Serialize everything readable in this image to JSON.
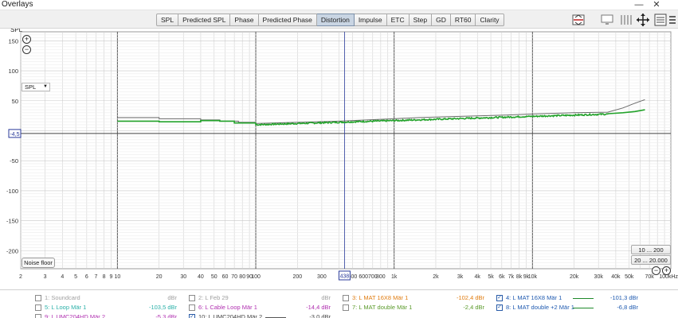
{
  "window": {
    "title": "Overlays",
    "minimize": "—",
    "close": "✕"
  },
  "toolbar": {
    "tabs": [
      "SPL",
      "Predicted SPL",
      "Phase",
      "Predicted Phase",
      "Distortion",
      "Impulse",
      "ETC",
      "Step",
      "GD",
      "RT60",
      "Clarity"
    ],
    "active_tab": "Distortion",
    "right_icons": [
      "compare-icon",
      "monitor-icon",
      "columns-icon",
      "move-arrows-icon",
      "controls-icon",
      "menu-icon"
    ]
  },
  "plot": {
    "y_axis_label": "SPL",
    "y_ticks": [
      "150",
      "100",
      "50",
      "-50",
      "-100",
      "-150",
      "-200"
    ],
    "y_marker": "-4,5",
    "x_ticks": [
      "2",
      "3",
      "4",
      "5",
      "6",
      "7",
      "8",
      "9",
      "10",
      "20",
      "30",
      "40",
      "50",
      "60",
      "70",
      "80",
      "90",
      "100",
      "200",
      "300",
      "500",
      "600",
      "700",
      "800",
      "1k",
      "2k",
      "3k",
      "4k",
      "5k",
      "6k",
      "7k",
      "8k",
      "9k",
      "10k",
      "20k",
      "30k",
      "40k",
      "50k",
      "70k",
      "100kHz"
    ],
    "x_marker": "438",
    "dropdown": "SPL",
    "noise_floor_button": "Noise floor",
    "range_buttons": [
      "10 ... 200",
      "20 ... 20.000"
    ],
    "zoom_in": "+",
    "zoom_out": "−",
    "colors": {
      "trace_green": "#22a22a",
      "trace_gray": "#6a6a6a",
      "cursor": "#2a3a9a"
    }
  },
  "legend": [
    {
      "num_name": "1: Soundcard",
      "value": "dBr",
      "checked": false,
      "color": "#a0a0a0",
      "text_color": "#a0a0a0"
    },
    {
      "num_name": "2: L Feb 29",
      "value": "dBr",
      "checked": false,
      "color": "#a0a0a0",
      "text_color": "#a0a0a0"
    },
    {
      "num_name": "3: L MAT 16X8 Mär 1",
      "value": "-102,4 dBr",
      "checked": false,
      "color": "#e07c10",
      "text_color": "#e07c10"
    },
    {
      "num_name": "4: L MAT 16X8 Mär 1",
      "value": "-101,3 dBr",
      "checked": true,
      "color": "#1f8a2a",
      "text_color": "#1f5ab0"
    },
    {
      "num_name": "5: L Loop Mär 1",
      "value": "-103,5 dBr",
      "checked": false,
      "color": "#2ab0a8",
      "text_color": "#2ab0a8"
    },
    {
      "num_name": "6: L Cable Loop Mär 1",
      "value": "-14,4 dBr",
      "checked": false,
      "color": "#b030b0",
      "text_color": "#b030b0"
    },
    {
      "num_name": "7: L MAT double Mär 1",
      "value": "-2,4 dBr",
      "checked": false,
      "color": "#5a9a2a",
      "text_color": "#5a9a2a"
    },
    {
      "num_name": "8: L MAT double +2 Mär 1",
      "value": "-6,8 dBr",
      "checked": true,
      "color": "#1f8a2a",
      "text_color": "#1f5ab0"
    },
    {
      "num_name": "9: L UMC204HD Mär 2",
      "value": "-5,3 dBr",
      "checked": false,
      "color": "#b030b0",
      "text_color": "#b030b0"
    },
    {
      "num_name": "10: L UMC204HD Mär 2",
      "value": "-3,0 dBr",
      "checked": true,
      "color": "#555555",
      "text_color": "#444444"
    }
  ]
}
